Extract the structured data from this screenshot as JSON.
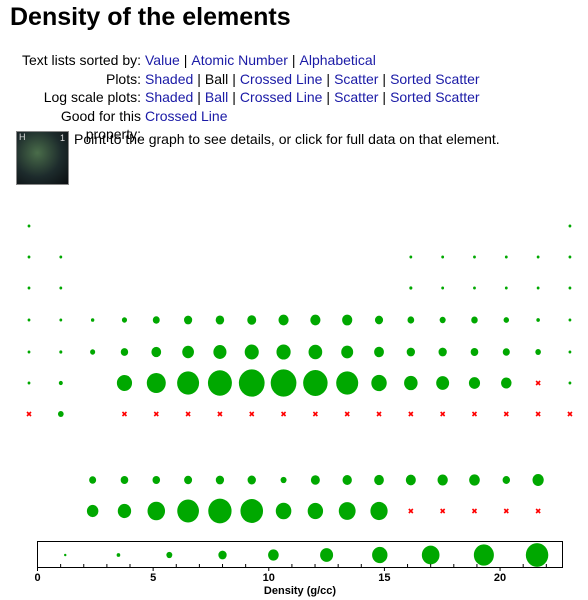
{
  "title": "Density of the elements",
  "nav": {
    "text_lists": {
      "label": "Text lists sorted by:",
      "links": [
        "Value",
        "Atomic Number",
        "Alphabetical"
      ]
    },
    "plots": {
      "label": "Plots:",
      "items": [
        {
          "text": "Shaded",
          "link": true
        },
        {
          "text": "Ball",
          "link": false
        },
        {
          "text": "Crossed Line",
          "link": true
        },
        {
          "text": "Scatter",
          "link": true
        },
        {
          "text": "Sorted Scatter",
          "link": true
        }
      ]
    },
    "log_plots": {
      "label": "Log scale plots:",
      "links": [
        "Shaded",
        "Ball",
        "Crossed Line",
        "Scatter",
        "Sorted Scatter"
      ]
    },
    "good_for": {
      "label": "Good for this property:",
      "links": [
        "Crossed Line"
      ]
    }
  },
  "thumbnail": {
    "symbol": "H",
    "number": "1"
  },
  "hint": "Point to the graph to see details, or click for full data on that element.",
  "colors": {
    "ball": "#00a800",
    "missing": "#ff0000",
    "link": "#1a1aa6"
  },
  "chart_data": {
    "type": "ball-periodic-table",
    "xlabel": "Density (g/cc)",
    "xlim": [
      0,
      22.7
    ],
    "ticks": [
      0,
      5,
      10,
      15,
      20
    ],
    "missing_marker": "n/a",
    "rows": [
      [
        8.99e-05,
        null,
        null,
        null,
        null,
        null,
        null,
        null,
        null,
        null,
        null,
        null,
        null,
        null,
        null,
        null,
        null,
        0.0001785
      ],
      [
        0.535,
        1.848,
        null,
        null,
        null,
        null,
        null,
        null,
        null,
        null,
        null,
        null,
        2.46,
        2.26,
        0.00125,
        0.00143,
        0.0017,
        0.0009
      ],
      [
        0.968,
        1.738,
        null,
        null,
        null,
        null,
        null,
        null,
        null,
        null,
        null,
        null,
        2.7,
        2.33,
        1.823,
        1.96,
        0.0032,
        0.00178
      ],
      [
        0.856,
        1.55,
        2.985,
        4.507,
        6.11,
        7.19,
        7.47,
        7.874,
        8.9,
        8.908,
        8.96,
        7.14,
        5.904,
        5.323,
        5.727,
        4.819,
        3.12,
        0.00375
      ],
      [
        1.532,
        2.63,
        4.472,
        6.511,
        8.57,
        10.28,
        11.5,
        12.37,
        12.45,
        12.023,
        10.49,
        8.65,
        7.31,
        7.31,
        6.697,
        6.24,
        4.94,
        0.0059
      ],
      [
        1.879,
        3.51,
        null,
        13.31,
        16.65,
        19.25,
        21.02,
        22.59,
        22.56,
        21.45,
        19.3,
        13.534,
        11.85,
        11.34,
        9.78,
        9.196,
        "n/a",
        0.00973
      ],
      [
        "n/a",
        5.0,
        null,
        "n/a",
        "n/a",
        "n/a",
        "n/a",
        "n/a",
        "n/a",
        "n/a",
        "n/a",
        "n/a",
        "n/a",
        "n/a",
        "n/a",
        "n/a",
        "n/a",
        "n/a"
      ]
    ],
    "lanthanides": [
      null,
      null,
      6.146,
      6.689,
      6.64,
      7.01,
      7.264,
      7.353,
      5.244,
      7.901,
      8.219,
      8.551,
      8.795,
      9.066,
      9.321,
      6.57,
      9.841,
      null
    ],
    "actinides": [
      null,
      null,
      10.07,
      11.724,
      15.37,
      19.05,
      20.45,
      19.816,
      13.67,
      13.51,
      14.78,
      15.1,
      "n/a",
      "n/a",
      "n/a",
      "n/a",
      "n/a",
      null
    ],
    "legend_values": [
      1.2,
      3.5,
      5.7,
      8.0,
      10.2,
      12.5,
      14.8,
      17.0,
      19.3,
      21.6
    ]
  }
}
